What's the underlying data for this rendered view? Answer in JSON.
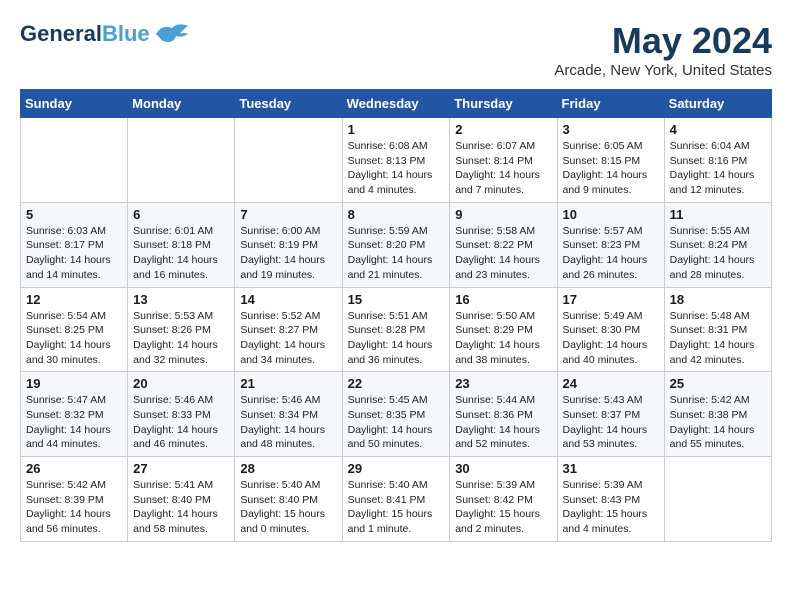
{
  "header": {
    "logo_general": "General",
    "logo_blue": "Blue",
    "month_title": "May 2024",
    "location": "Arcade, New York, United States"
  },
  "days_of_week": [
    "Sunday",
    "Monday",
    "Tuesday",
    "Wednesday",
    "Thursday",
    "Friday",
    "Saturday"
  ],
  "weeks": [
    [
      {
        "day": "",
        "info": ""
      },
      {
        "day": "",
        "info": ""
      },
      {
        "day": "",
        "info": ""
      },
      {
        "day": "1",
        "info": "Sunrise: 6:08 AM\nSunset: 8:13 PM\nDaylight: 14 hours\nand 4 minutes."
      },
      {
        "day": "2",
        "info": "Sunrise: 6:07 AM\nSunset: 8:14 PM\nDaylight: 14 hours\nand 7 minutes."
      },
      {
        "day": "3",
        "info": "Sunrise: 6:05 AM\nSunset: 8:15 PM\nDaylight: 14 hours\nand 9 minutes."
      },
      {
        "day": "4",
        "info": "Sunrise: 6:04 AM\nSunset: 8:16 PM\nDaylight: 14 hours\nand 12 minutes."
      }
    ],
    [
      {
        "day": "5",
        "info": "Sunrise: 6:03 AM\nSunset: 8:17 PM\nDaylight: 14 hours\nand 14 minutes."
      },
      {
        "day": "6",
        "info": "Sunrise: 6:01 AM\nSunset: 8:18 PM\nDaylight: 14 hours\nand 16 minutes."
      },
      {
        "day": "7",
        "info": "Sunrise: 6:00 AM\nSunset: 8:19 PM\nDaylight: 14 hours\nand 19 minutes."
      },
      {
        "day": "8",
        "info": "Sunrise: 5:59 AM\nSunset: 8:20 PM\nDaylight: 14 hours\nand 21 minutes."
      },
      {
        "day": "9",
        "info": "Sunrise: 5:58 AM\nSunset: 8:22 PM\nDaylight: 14 hours\nand 23 minutes."
      },
      {
        "day": "10",
        "info": "Sunrise: 5:57 AM\nSunset: 8:23 PM\nDaylight: 14 hours\nand 26 minutes."
      },
      {
        "day": "11",
        "info": "Sunrise: 5:55 AM\nSunset: 8:24 PM\nDaylight: 14 hours\nand 28 minutes."
      }
    ],
    [
      {
        "day": "12",
        "info": "Sunrise: 5:54 AM\nSunset: 8:25 PM\nDaylight: 14 hours\nand 30 minutes."
      },
      {
        "day": "13",
        "info": "Sunrise: 5:53 AM\nSunset: 8:26 PM\nDaylight: 14 hours\nand 32 minutes."
      },
      {
        "day": "14",
        "info": "Sunrise: 5:52 AM\nSunset: 8:27 PM\nDaylight: 14 hours\nand 34 minutes."
      },
      {
        "day": "15",
        "info": "Sunrise: 5:51 AM\nSunset: 8:28 PM\nDaylight: 14 hours\nand 36 minutes."
      },
      {
        "day": "16",
        "info": "Sunrise: 5:50 AM\nSunset: 8:29 PM\nDaylight: 14 hours\nand 38 minutes."
      },
      {
        "day": "17",
        "info": "Sunrise: 5:49 AM\nSunset: 8:30 PM\nDaylight: 14 hours\nand 40 minutes."
      },
      {
        "day": "18",
        "info": "Sunrise: 5:48 AM\nSunset: 8:31 PM\nDaylight: 14 hours\nand 42 minutes."
      }
    ],
    [
      {
        "day": "19",
        "info": "Sunrise: 5:47 AM\nSunset: 8:32 PM\nDaylight: 14 hours\nand 44 minutes."
      },
      {
        "day": "20",
        "info": "Sunrise: 5:46 AM\nSunset: 8:33 PM\nDaylight: 14 hours\nand 46 minutes."
      },
      {
        "day": "21",
        "info": "Sunrise: 5:46 AM\nSunset: 8:34 PM\nDaylight: 14 hours\nand 48 minutes."
      },
      {
        "day": "22",
        "info": "Sunrise: 5:45 AM\nSunset: 8:35 PM\nDaylight: 14 hours\nand 50 minutes."
      },
      {
        "day": "23",
        "info": "Sunrise: 5:44 AM\nSunset: 8:36 PM\nDaylight: 14 hours\nand 52 minutes."
      },
      {
        "day": "24",
        "info": "Sunrise: 5:43 AM\nSunset: 8:37 PM\nDaylight: 14 hours\nand 53 minutes."
      },
      {
        "day": "25",
        "info": "Sunrise: 5:42 AM\nSunset: 8:38 PM\nDaylight: 14 hours\nand 55 minutes."
      }
    ],
    [
      {
        "day": "26",
        "info": "Sunrise: 5:42 AM\nSunset: 8:39 PM\nDaylight: 14 hours\nand 56 minutes."
      },
      {
        "day": "27",
        "info": "Sunrise: 5:41 AM\nSunset: 8:40 PM\nDaylight: 14 hours\nand 58 minutes."
      },
      {
        "day": "28",
        "info": "Sunrise: 5:40 AM\nSunset: 8:40 PM\nDaylight: 15 hours\nand 0 minutes."
      },
      {
        "day": "29",
        "info": "Sunrise: 5:40 AM\nSunset: 8:41 PM\nDaylight: 15 hours\nand 1 minute."
      },
      {
        "day": "30",
        "info": "Sunrise: 5:39 AM\nSunset: 8:42 PM\nDaylight: 15 hours\nand 2 minutes."
      },
      {
        "day": "31",
        "info": "Sunrise: 5:39 AM\nSunset: 8:43 PM\nDaylight: 15 hours\nand 4 minutes."
      },
      {
        "day": "",
        "info": ""
      }
    ]
  ]
}
